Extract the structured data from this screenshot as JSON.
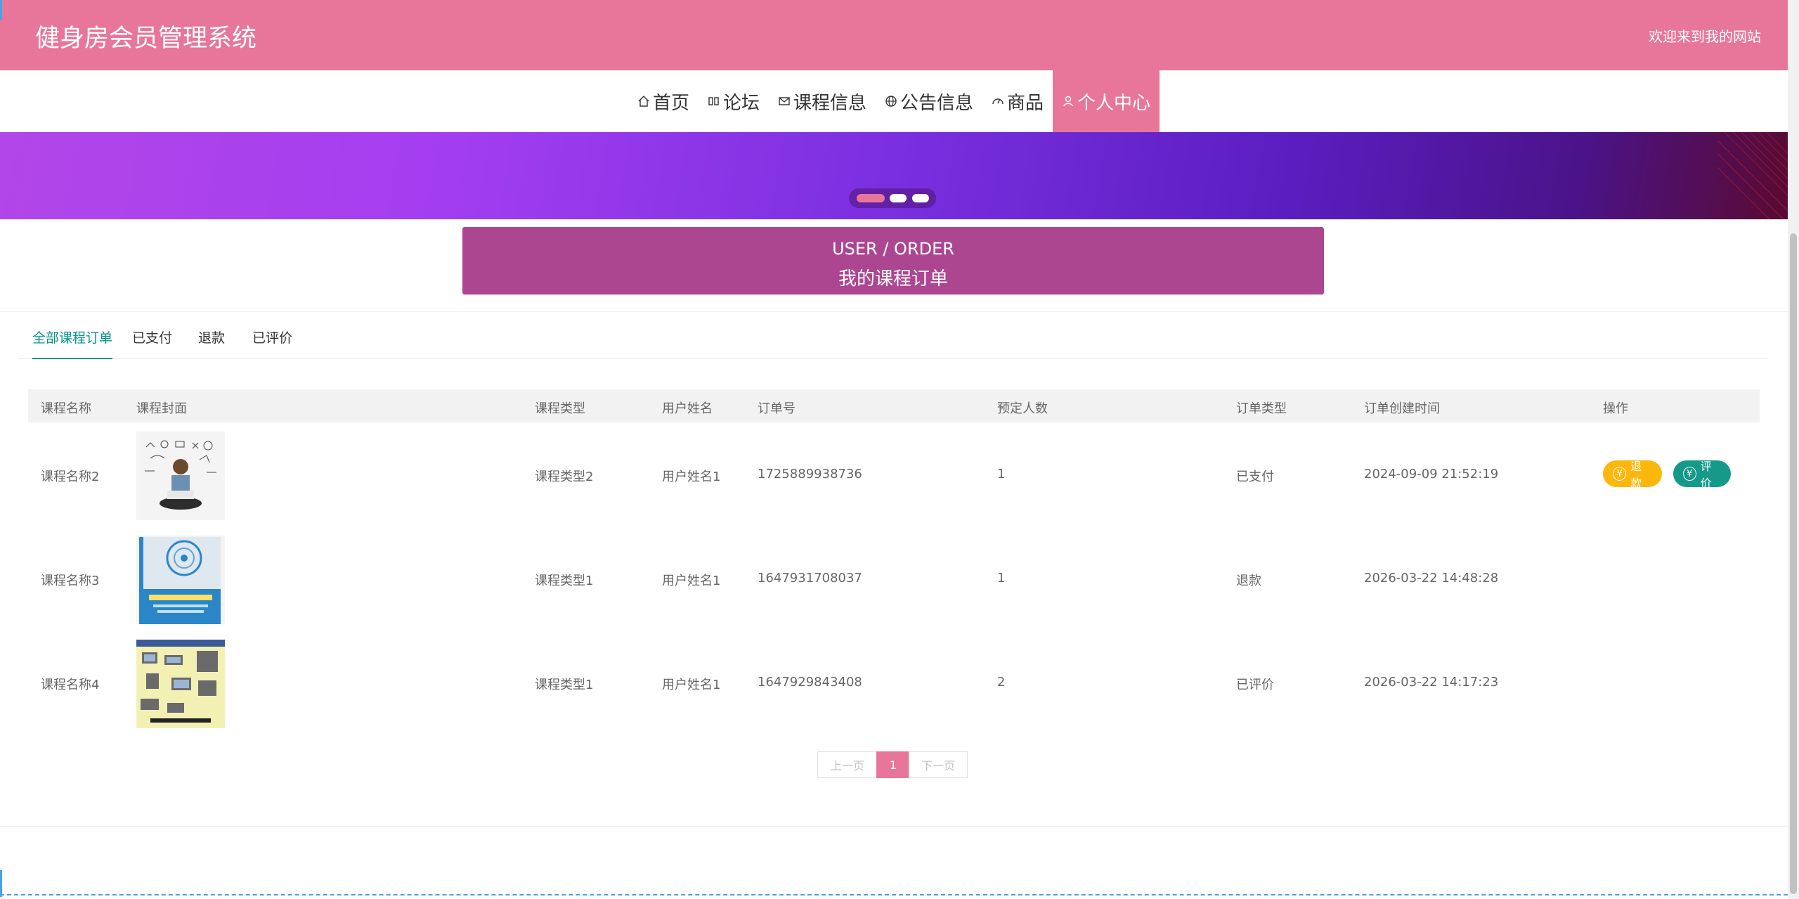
{
  "header": {
    "title": "健身房会员管理系统",
    "welcome": "欢迎来到我的网站"
  },
  "nav": {
    "items": [
      {
        "label": "首页",
        "icon": "home-icon"
      },
      {
        "label": "论坛",
        "icon": "forum-icon"
      },
      {
        "label": "课程信息",
        "icon": "mail-icon"
      },
      {
        "label": "公告信息",
        "icon": "globe-icon"
      },
      {
        "label": "商品",
        "icon": "gauge-icon"
      },
      {
        "label": "个人中心",
        "icon": "user-icon",
        "active": true
      }
    ]
  },
  "banner": {
    "dots": 3,
    "active_dot": 0
  },
  "order_banner": {
    "subtitle": "USER / ORDER",
    "title": "我的课程订单"
  },
  "tabs": [
    "全部课程订单",
    "已支付",
    "退款",
    "已评价"
  ],
  "table": {
    "headers": [
      "课程名称",
      "课程封面",
      "课程类型",
      "用户姓名",
      "订单号",
      "预定人数",
      "订单类型",
      "订单创建时间",
      "操作"
    ],
    "rows": [
      {
        "name": "课程名称2",
        "type": "课程类型2",
        "user": "用户姓名1",
        "order_no": "1725889938736",
        "count": "1",
        "status": "已支付",
        "created": "2024-09-09 21:52:19",
        "actions": [
          "退款",
          "评价"
        ]
      },
      {
        "name": "课程名称3",
        "type": "课程类型1",
        "user": "用户姓名1",
        "order_no": "1647931708037",
        "count": "1",
        "status": "退款",
        "created": "2026-03-22 14:48:28",
        "actions": []
      },
      {
        "name": "课程名称4",
        "type": "课程类型1",
        "user": "用户姓名1",
        "order_no": "1647929843408",
        "count": "2",
        "status": "已评价",
        "created": "2026-03-22 14:17:23",
        "actions": []
      }
    ]
  },
  "pager": {
    "prev": "上一页",
    "current": "1",
    "next": "下一页"
  },
  "buttons": {
    "refund_icon": "¥",
    "review_icon": "¥"
  },
  "colors": {
    "primary": "#e7769a",
    "banner": "#ad4690",
    "teal": "#009688",
    "refund": "#fbb70b",
    "review": "#159a8a"
  }
}
